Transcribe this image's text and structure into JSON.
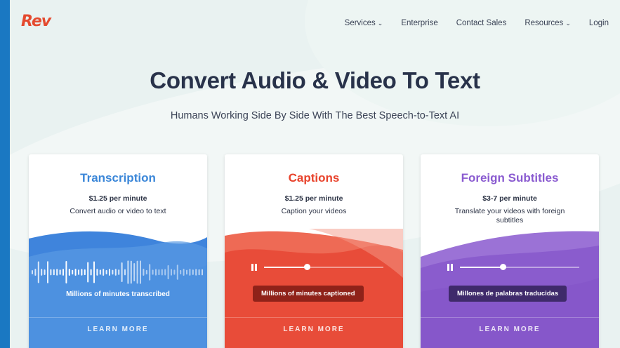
{
  "header": {
    "logo_text": "Rev",
    "nav": [
      {
        "label": "Services",
        "dropdown": true
      },
      {
        "label": "Enterprise",
        "dropdown": false
      },
      {
        "label": "Contact Sales",
        "dropdown": false
      },
      {
        "label": "Resources",
        "dropdown": true
      },
      {
        "label": "Login",
        "dropdown": false
      }
    ],
    "chevron_icon": "chevron-down-icon"
  },
  "hero": {
    "title": "Convert Audio & Video To Text",
    "subtitle": "Humans Working Side By Side With The Best Speech-to-Text AI"
  },
  "cards": [
    {
      "title": "Transcription",
      "price": "$1.25 per minute",
      "description": "Convert audio or video to text",
      "caption": "Millions of minutes transcribed",
      "learn_more": "LEARN MORE",
      "visual": "waveform",
      "title_color": "#3a86d8",
      "panel_color": "#4a8fe0"
    },
    {
      "title": "Captions",
      "price": "$1.25 per minute",
      "description": "Caption your videos",
      "caption": "Millions of minutes captioned",
      "learn_more": "LEARN MORE",
      "visual": "player",
      "progress": 0.36,
      "title_color": "#e8432c",
      "panel_color": "#ea4c39"
    },
    {
      "title": "Foreign Subtitles",
      "price": "$3-7 per minute",
      "description": "Translate your videos with foreign subtitles",
      "caption": "Millones de palabras traducidas",
      "learn_more": "LEARN MORE",
      "visual": "player",
      "progress": 0.36,
      "title_color": "#8a5bd0",
      "panel_color": "#8b5ccf"
    }
  ],
  "colors": {
    "frame": "#1a78c2",
    "page_bg": "#e9f2f1",
    "heading": "#28324a",
    "logo": "#e44a2f"
  }
}
